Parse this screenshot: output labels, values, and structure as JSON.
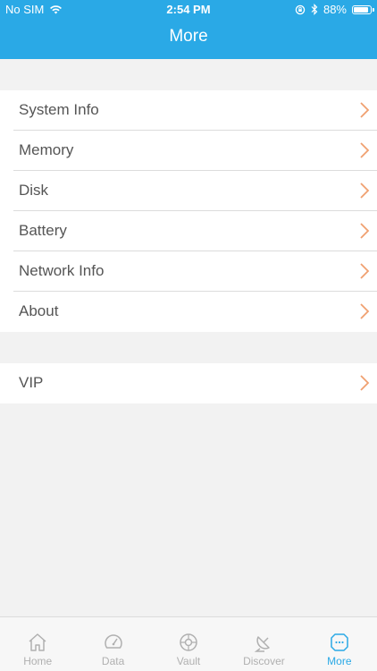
{
  "status_bar": {
    "carrier": "No SIM",
    "time": "2:54 PM",
    "battery_percent": "88%",
    "battery_level": 0.88
  },
  "nav": {
    "title": "More"
  },
  "sections": [
    {
      "items": [
        {
          "label": "System Info"
        },
        {
          "label": "Memory"
        },
        {
          "label": "Disk"
        },
        {
          "label": "Battery"
        },
        {
          "label": "Network Info"
        },
        {
          "label": "About"
        }
      ]
    },
    {
      "items": [
        {
          "label": "VIP"
        }
      ]
    }
  ],
  "tabbar": {
    "tabs": [
      {
        "label": "Home",
        "icon": "home-icon",
        "active": false
      },
      {
        "label": "Data",
        "icon": "speedometer-icon",
        "active": false
      },
      {
        "label": "Vault",
        "icon": "vault-icon",
        "active": false
      },
      {
        "label": "Discover",
        "icon": "satellite-dish-icon",
        "active": false
      },
      {
        "label": "More",
        "icon": "more-icon",
        "active": true
      }
    ]
  },
  "colors": {
    "accent": "#2aa9e6",
    "chevron": "#f0a070",
    "background": "#f2f2f2",
    "inactive_tab": "#b0b0b0"
  }
}
